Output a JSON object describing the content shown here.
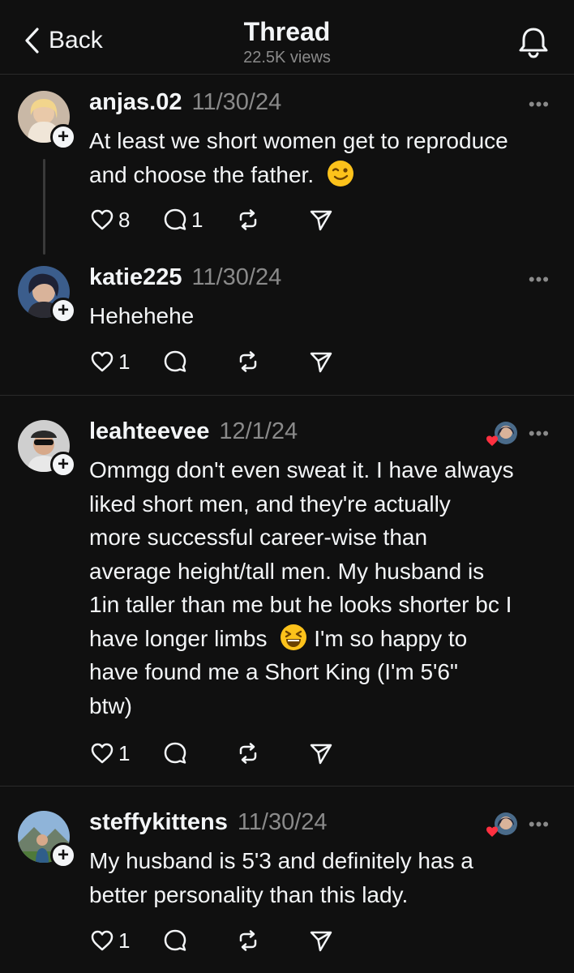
{
  "header": {
    "back_label": "Back",
    "title": "Thread",
    "views": "22.5K views"
  },
  "posts": [
    {
      "username": "anjas.02",
      "date": "11/30/24",
      "lines": [
        "At least we short women get to reproduce",
        "and choose the father."
      ],
      "emoji": "winking-face",
      "likes": "8",
      "replies": "1"
    },
    {
      "username": "katie225",
      "date": "11/30/24",
      "lines": [
        "Hehehehe"
      ],
      "likes": "1",
      "replies": ""
    },
    {
      "username": "leahteevee",
      "date": "12/1/24",
      "lines": [
        "Ommgg don't even sweat it. I have always",
        "liked short men, and they're actually",
        "more successful career-wise than",
        "average height/tall men. My husband is",
        "1in taller than me but he looks shorter bc I",
        "have longer limbs",
        "have found me a Short King (I'm 5'6\"",
        "btw)"
      ],
      "line6_tail": "I'm so happy to",
      "emoji": "grinning-squinting-face",
      "likes": "1",
      "replies": ""
    },
    {
      "username": "steffykittens",
      "date": "11/30/24",
      "lines": [
        "My husband is 5'3 and definitely has a",
        "better personality than this lady."
      ],
      "likes": "1",
      "replies": ""
    }
  ],
  "icons": {
    "more": "more-icon",
    "like": "heart-icon",
    "reply": "comment-icon",
    "repost": "repost-icon",
    "share": "share-icon",
    "notifications": "bell-icon"
  },
  "more_glyph": "•••",
  "plus_glyph": "+",
  "colors": {
    "background": "#101010",
    "text": "#f3f5f7",
    "muted": "#8a8a8a",
    "heart_red": "#ff3040"
  }
}
